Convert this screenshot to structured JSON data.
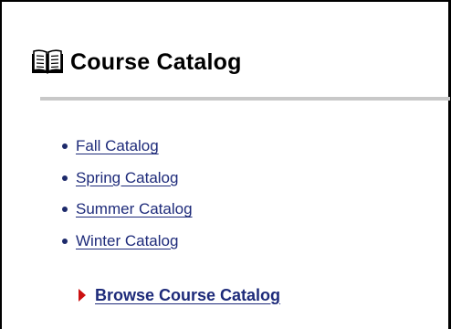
{
  "header": {
    "title": "Course Catalog",
    "icon": "open-book-icon"
  },
  "catalogs": [
    {
      "label": "Fall Catalog"
    },
    {
      "label": "Spring Catalog"
    },
    {
      "label": "Summer Catalog"
    },
    {
      "label": "Winter Catalog"
    }
  ],
  "browse": {
    "label": "Browse Course Catalog",
    "icon": "red-arrow-icon"
  },
  "colors": {
    "link": "#1e2b7a",
    "arrow": "#cc1111",
    "rule": "#c8c8c8",
    "border": "#000000"
  }
}
